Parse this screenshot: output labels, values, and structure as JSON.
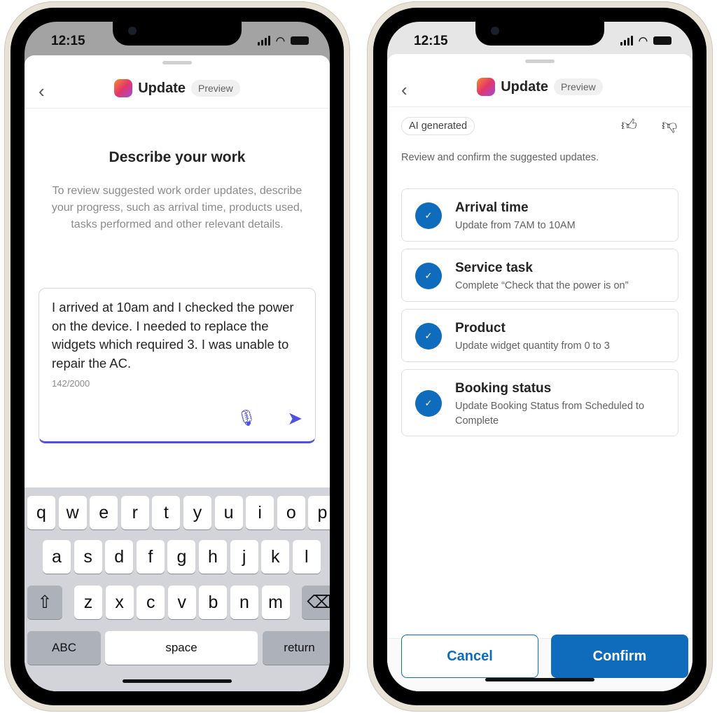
{
  "status": {
    "time": "12:15"
  },
  "header": {
    "title": "Update",
    "badge": "Preview"
  },
  "left": {
    "heading": "Describe your work",
    "instructions": "To review suggested work order updates, describe your progress, such as arrival time, products used, tasks performed and other relevant details.",
    "input_value": "I arrived at 10am and I checked the power on the device. I needed to replace the widgets which required 3. I was unable to repair the AC.",
    "char_count": "142/2000",
    "keyboard": {
      "row1": [
        "q",
        "w",
        "e",
        "r",
        "t",
        "y",
        "u",
        "i",
        "o",
        "p"
      ],
      "row2": [
        "a",
        "s",
        "d",
        "f",
        "g",
        "h",
        "j",
        "k",
        "l"
      ],
      "row3": [
        "z",
        "x",
        "c",
        "v",
        "b",
        "n",
        "m"
      ],
      "abc": "ABC",
      "space": "space",
      "return": "return"
    }
  },
  "right": {
    "ai_badge": "AI generated",
    "instruction": "Review and confirm the suggested updates.",
    "updates": [
      {
        "title": "Arrival time",
        "detail": "Update from 7AM to 10AM",
        "checked": true
      },
      {
        "title": "Service task",
        "detail": "Complete “Check that the power is on”",
        "checked": true
      },
      {
        "title": "Product",
        "detail": "Update widget quantity from 0 to 3",
        "checked": true
      },
      {
        "title": "Booking status",
        "detail": "Update Booking Status from Scheduled to Complete",
        "checked": true
      }
    ],
    "cancel": "Cancel",
    "confirm": "Confirm"
  },
  "colors": {
    "accent": "#0f6cbd",
    "send": "#4f52e0"
  }
}
